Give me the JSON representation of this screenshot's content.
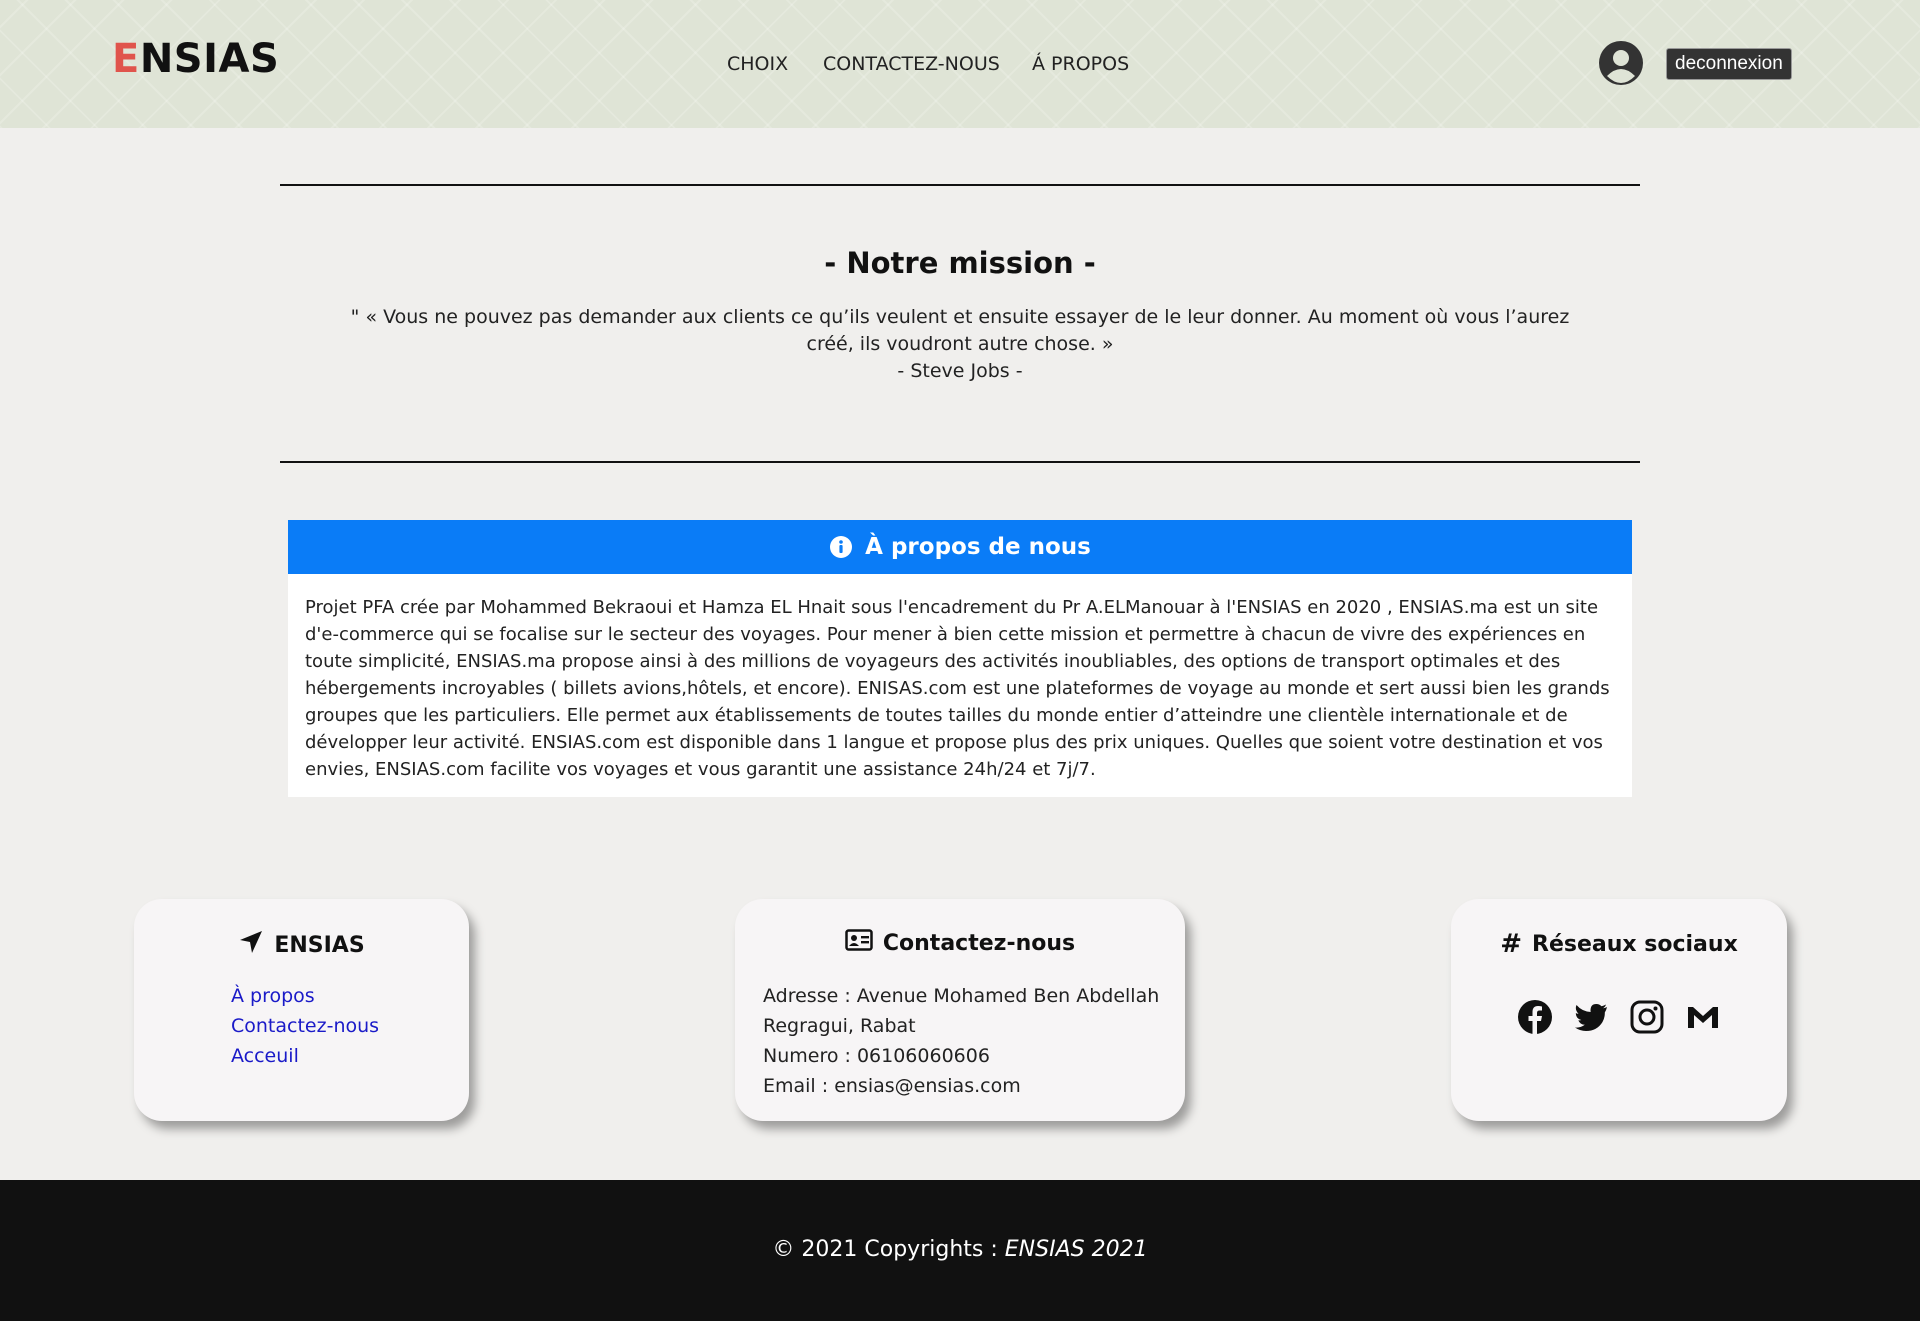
{
  "header": {
    "logo_first": "E",
    "logo_rest": "NSIAS",
    "nav": [
      "CHOIX",
      "CONTACTEZ-NOUS",
      "Á PROPOS"
    ],
    "logout_label": "deconnexion"
  },
  "mission": {
    "title": "- Notre mission -",
    "quote": "\" « Vous ne pouvez pas demander aux clients ce qu’ils veulent et ensuite essayer de le leur donner. Au moment où vous l’aurez créé, ils voudront autre chose. »",
    "author": "- Steve Jobs -"
  },
  "about": {
    "title": "À propos de nous",
    "body": "Projet PFA crée par Mohammed Bekraoui et Hamza EL Hnait sous l'encadrement du Pr A.ELManouar à l'ENSIAS en 2020 , ENSIAS.ma est un site d'e-commerce qui se focalise sur le secteur des voyages. Pour mener à bien cette mission et permettre à chacun de vivre des expériences en toute simplicité, ENSIAS.ma propose ainsi à des millions de voyageurs des activités inoubliables, des options de transport optimales et des hébergements incroyables ( billets avions,hôtels, et encore). ENISAS.com est une plateformes de voyage au monde et sert aussi bien les grands groupes que les particuliers. Elle permet aux établissements de toutes tailles du monde entier d’atteindre une clientèle internationale et de développer leur activité. ENSIAS.com est disponible dans 1 langue et propose plus des prix uniques. Quelles que soient votre destination et vos envies, ENSIAS.com facilite vos voyages et vous garantit une assistance 24h/24 et 7j/7."
  },
  "footer": {
    "ensias": {
      "title": "ENSIAS",
      "links": [
        "À propos",
        "Contactez-nous",
        "Acceuil"
      ]
    },
    "contact": {
      "title": "Contactez-nous",
      "lines": [
        "Adresse : Avenue Mohamed Ben Abdellah",
        "Regragui, Rabat",
        "Numero : 06106060606",
        "Email : ensias@ensias.com"
      ]
    },
    "social": {
      "title": "Réseaux sociaux",
      "icons": [
        "facebook-icon",
        "twitter-icon",
        "instagram-icon",
        "gmail-icon"
      ]
    }
  },
  "copyright": {
    "prefix": "© 2021 Copyrights : ",
    "brand": "ENSIAS 2021"
  },
  "colors": {
    "accent": "#0a7cf7",
    "logo_first_letter": "#e0544c",
    "header_bg": "#dfe4d6",
    "footer_bg": "#111111",
    "link": "#1a1ac8"
  }
}
